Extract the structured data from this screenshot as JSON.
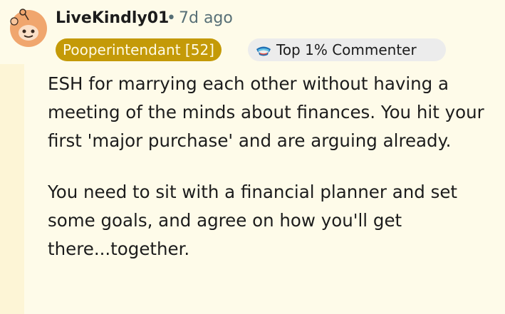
{
  "comment": {
    "username": "LiveKindly01",
    "separator": "•",
    "timestamp": "7d ago",
    "flair": "Pooperintendant [52]",
    "badge": {
      "label": "Top 1% Commenter",
      "icon": "commenter-badge-icon"
    },
    "paragraphs": [
      "ESH for marrying each other without having a meeting of the minds about finances. You hit your first 'major purchase' and are arguing already.",
      "You need to sit with a financial planner and set some goals, and agree on how you'll get there...together."
    ]
  },
  "colors": {
    "background": "#fefbe9",
    "flair_bg": "#c49a08",
    "badge_bg": "#ececec",
    "meta_text": "#576f76",
    "avatar_orange": "#f0a66e"
  }
}
